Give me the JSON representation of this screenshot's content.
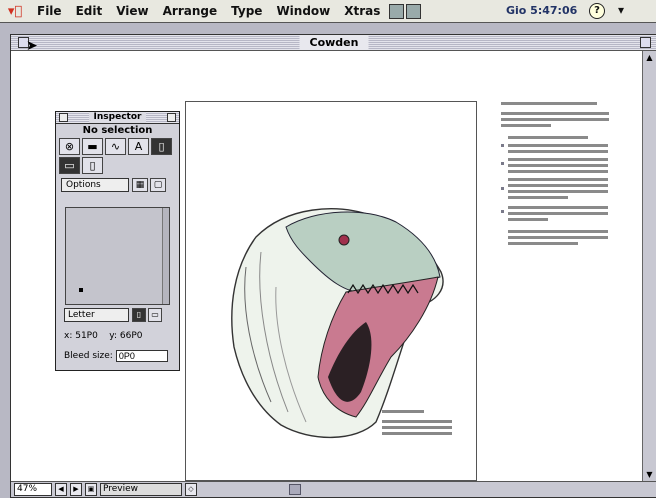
{
  "menubar": {
    "items": [
      "File",
      "Edit",
      "View",
      "Arrange",
      "Type",
      "Window",
      "Xtras"
    ],
    "clock": "Gio 5:47:06",
    "help_glyph": "?"
  },
  "document": {
    "title": "Cowden",
    "zoom": "47%",
    "view_mode": "Preview"
  },
  "inspector": {
    "title": "Inspector",
    "subtitle": "No selection",
    "options_label": "Options",
    "paper_size": "Letter",
    "x_label": "x:",
    "x_value": "51P0",
    "y_label": "y:",
    "y_value": "66P0",
    "bleed_label": "Bleed size:",
    "bleed_value": "0P0",
    "tool_text_glyph": "A"
  },
  "icons": [
    "apple-icon",
    "close-box-icon",
    "zoom-box-icon",
    "arrow-cursor-icon",
    "help-icon",
    "scroll-up-arrow-icon",
    "scroll-down-arrow-icon",
    "dinosaur-illustration"
  ]
}
